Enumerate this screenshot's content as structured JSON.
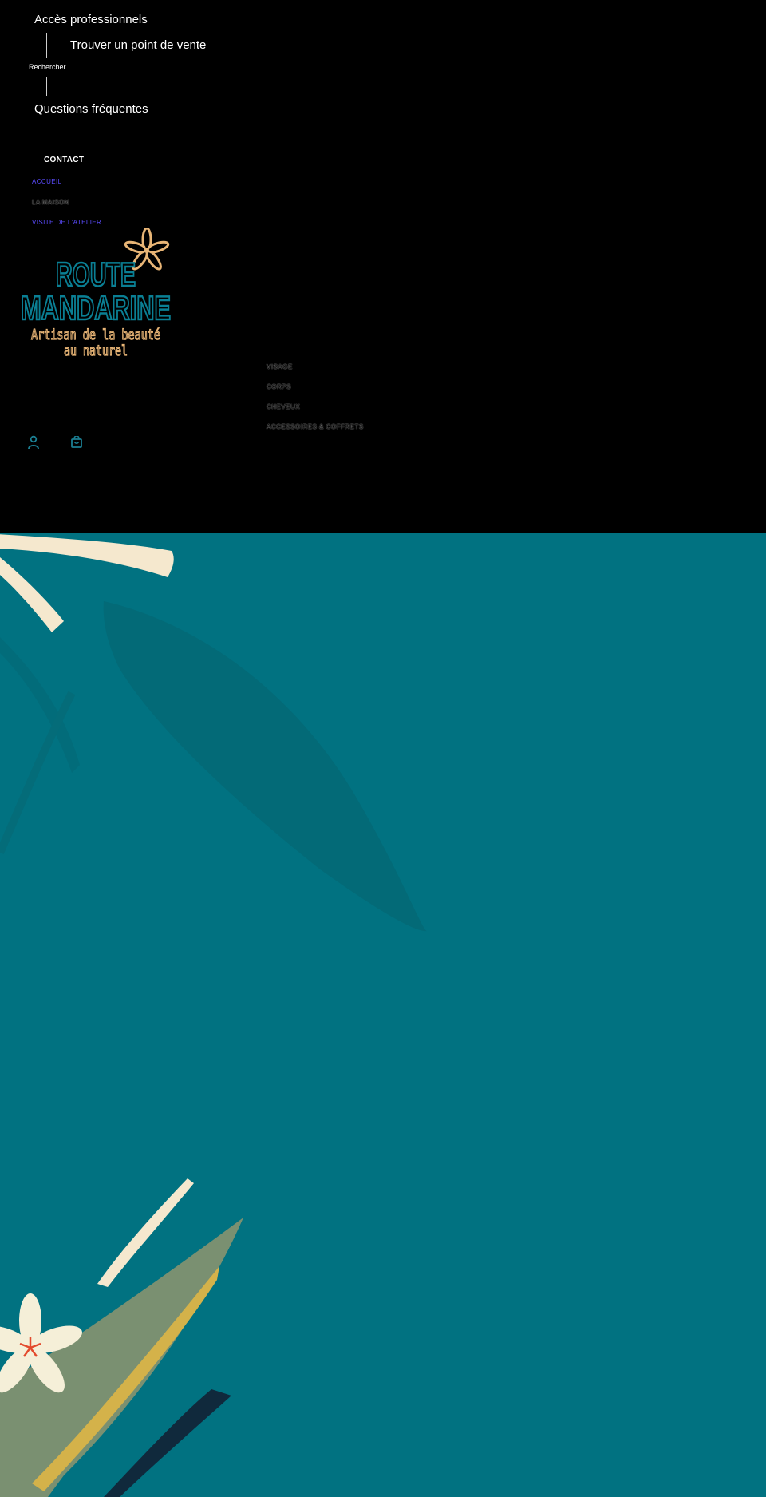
{
  "topbar": {
    "pro_access": "Accès professionnels",
    "store_locator": "Trouver un point de vente",
    "search_placeholder": "Rechercher...",
    "faq": "Questions fréquentes"
  },
  "menu": {
    "contact": "CONTACT",
    "items": [
      "ACCUEIL",
      "LA MAISON",
      "VISITE DE L'ATELIER"
    ]
  },
  "brand": {
    "line1": "ROUTE",
    "line2": "MANDARINE",
    "tagline1": "Artisan de la beauté",
    "tagline2": "au naturel"
  },
  "main_nav": {
    "items": [
      "VISAGE",
      "CORPS",
      "CHEVEUX",
      "ACCESSOIRES & COFFRETS"
    ]
  },
  "icons": {
    "account": "account-icon",
    "cart": "cart-icon"
  },
  "colors": {
    "hero_bg": "#017281",
    "brand_teal": "#0a7f94",
    "brand_sand": "#e8b576",
    "link_blue": "#5b4cff"
  }
}
